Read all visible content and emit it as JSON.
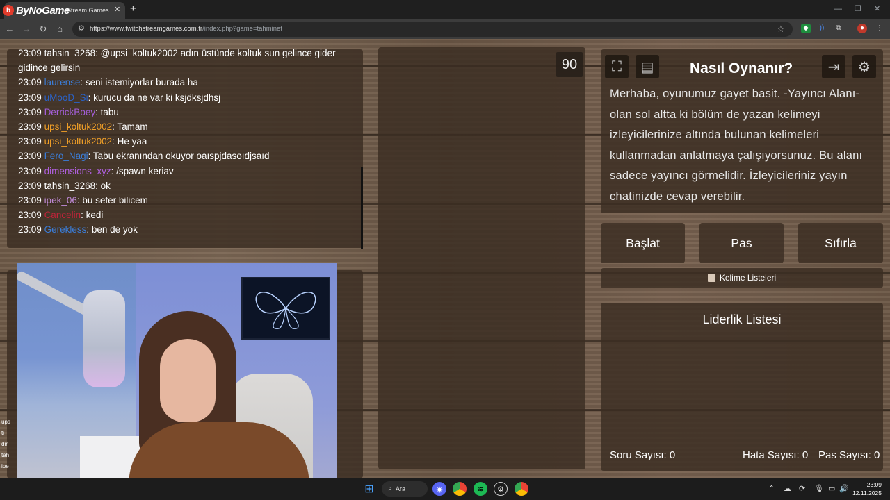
{
  "browser": {
    "logo_text": "ByNoGame",
    "tab_title": "Stream Games",
    "url_host": "https://www.twitchstreamgames.com.tr",
    "url_path": "/index.php?game=tahminet"
  },
  "chat": {
    "messages": [
      {
        "time": "23:09",
        "user": "tahsin_3268",
        "color": "#ffffff",
        "text": ": @upsi_koltuk2002 adın üstünde koltuk sun gelince gider gidince gelirsin"
      },
      {
        "time": "23:09",
        "user": "laurense",
        "color": "#3b7dd8",
        "text": ": seni istemiyorlar burada ha"
      },
      {
        "time": "23:09",
        "user": "uMooD_Si",
        "color": "#2a62c8",
        "text": ": kurucu da ne var ki ksjdksjdhsj"
      },
      {
        "time": "23:09",
        "user": "DerrickBoey",
        "color": "#a45fd9",
        "text": ": tabu"
      },
      {
        "time": "23:09",
        "user": "upsi_koltuk2002",
        "color": "#f2a027",
        "text": ": Tamam"
      },
      {
        "time": "23:09",
        "user": "upsi_koltuk2002",
        "color": "#f2a027",
        "text": ": He yaa"
      },
      {
        "time": "23:09",
        "user": "Fero_Nagi",
        "color": "#3b7dd8",
        "text": ": Tabu ekranından okuyor oaıspjdasoıdjsaıd"
      },
      {
        "time": "23:09",
        "user": "dimensions_xyz",
        "color": "#b060e0",
        "text": ": /spawn keriav"
      },
      {
        "time": "23:09",
        "user": "tahsin_3268",
        "color": "#ffffff",
        "text": ": ok"
      },
      {
        "time": "23:09",
        "user": "ipek_06",
        "color": "#c08ad8",
        "text": ": bu sefer bilicem"
      },
      {
        "time": "23:09",
        "user": "Cancelin",
        "color": "#c2233a",
        "text": ": kedi"
      },
      {
        "time": "23:09",
        "user": "Gerekless",
        "color": "#3b7dd8",
        "text": ": ben de yok"
      }
    ]
  },
  "game": {
    "timer": "90",
    "howto_title": "Nasıl Oynanır?",
    "howto_text": "Merhaba, oyunumuz gayet basit. -Yayıncı Alanı- olan sol altta ki bölüm de yazan kelimeyi izleyicilerinize altında bulunan kelimeleri kullanmadan anlatmaya çalışıyorsunuz. Bu alanı sadece yayıncı görmelidir. İzleyicileriniz yayın chatinizde cevap verebilir.",
    "buttons": {
      "start": "Başlat",
      "pass": "Pas",
      "reset": "Sıfırla"
    },
    "word_lists": "Kelime Listeleri",
    "leaderboard_title": "Liderlik Listesi",
    "stats": {
      "questions_label": "Soru Sayısı:",
      "questions": "0",
      "errors_label": "Hata Sayısı:",
      "errors": "0",
      "passes_label": "Pas Sayısı:",
      "passes": "0"
    }
  },
  "side_chat_icons": [
    "ups",
    "ti",
    "dir",
    "tah",
    "ipe",
    ""
  ],
  "taskbar": {
    "search": "Ara",
    "time": "23:09",
    "date": "12.11.2025"
  }
}
